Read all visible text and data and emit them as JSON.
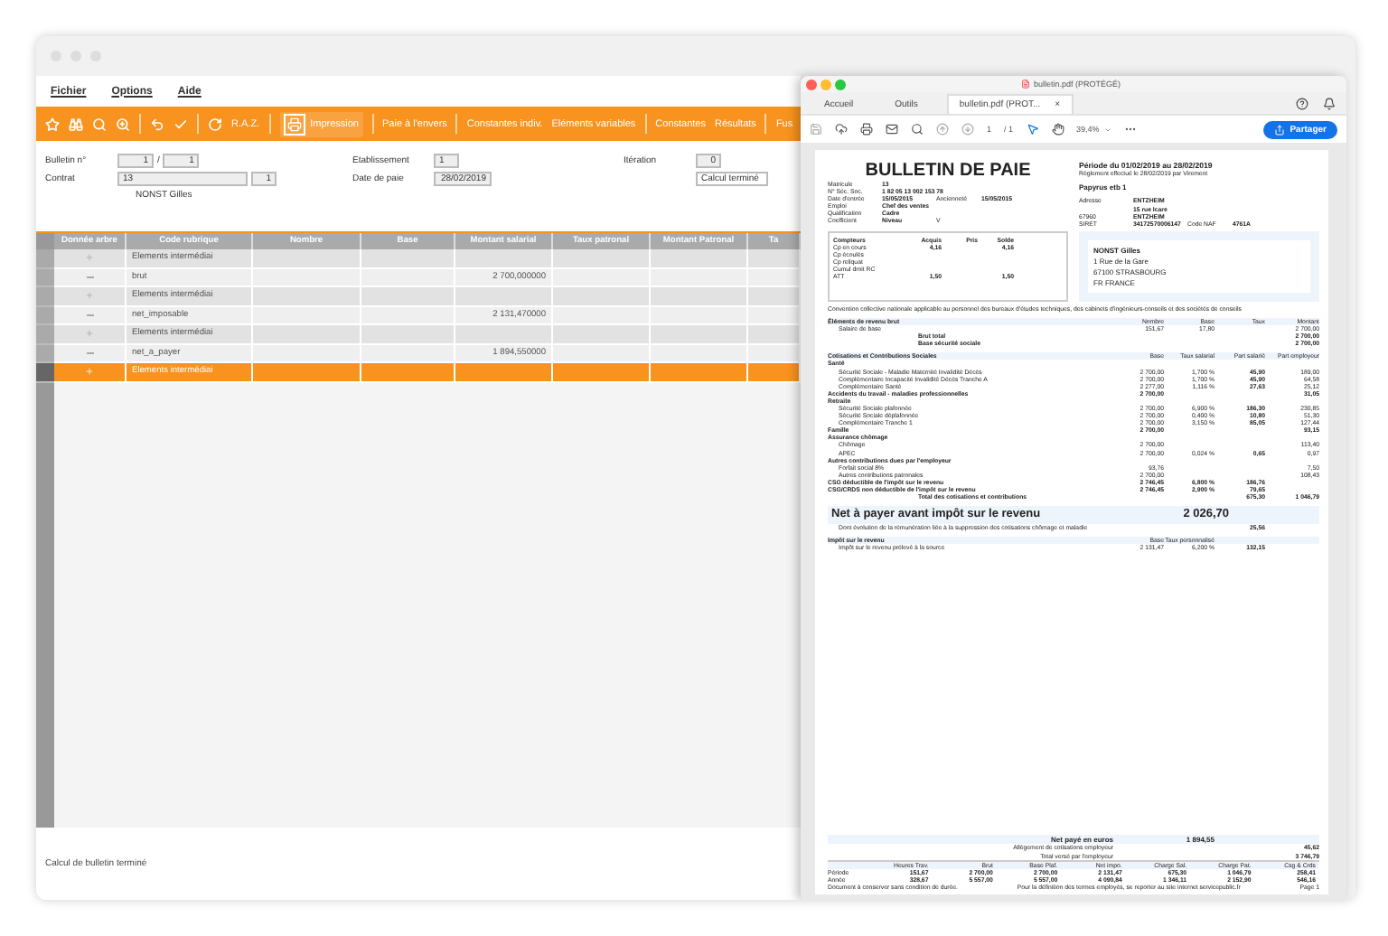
{
  "app": {
    "menu": [
      "Fichier",
      "Options",
      "Aide"
    ],
    "toolbar": [
      {
        "kind": "icon"
      },
      {
        "kind": "icon"
      },
      {
        "kind": "icon"
      },
      {
        "kind": "icon"
      },
      {
        "kind": "sep"
      },
      {
        "kind": "icon"
      },
      {
        "kind": "icon"
      },
      {
        "kind": "sep"
      },
      {
        "kind": "icon"
      },
      {
        "kind": "text",
        "label": "R.A.Z."
      },
      {
        "kind": "sep"
      },
      {
        "kind": "print",
        "label": "Impression",
        "selected": true
      },
      {
        "kind": "sep"
      },
      {
        "kind": "text",
        "label": "Paie à l'envers"
      },
      {
        "kind": "sep"
      },
      {
        "kind": "text",
        "label": "Constantes indiv."
      },
      {
        "kind": "text",
        "label": "Eléments variables"
      },
      {
        "kind": "sep"
      },
      {
        "kind": "text",
        "label": "Constantes"
      },
      {
        "kind": "text",
        "label": "Résultats"
      },
      {
        "kind": "sep"
      },
      {
        "kind": "text",
        "label": "Fus"
      }
    ],
    "form": {
      "bulletin_label": "Bulletin n°",
      "bulletin": "1",
      "bulletin_sep": "/",
      "bulletin_total": "1",
      "etablissement_label": "Etablissement",
      "etablissement": "1",
      "iteration_label": "Itération",
      "iteration": "0",
      "contrat_label": "Contrat",
      "contrat": "13",
      "contrat_num": "1",
      "date_label": "Date de paie",
      "date": "28/02/2019",
      "status": "Calcul terminé",
      "employee": "NONST Gilles"
    },
    "table": {
      "columns": [
        "Donnée arbre",
        "Code rubrique",
        "Nombre",
        "Base",
        "Montant salarial",
        "Taux patronal",
        "Montant Patronal",
        "Ta"
      ],
      "rows": [
        {
          "kind": "group",
          "selected": false,
          "code": "Elements intermédiai"
        },
        {
          "kind": "leaf",
          "selected": false,
          "code": "brut",
          "amount": "2 700,000000"
        },
        {
          "kind": "group",
          "selected": false,
          "code": "Elements intermédiai"
        },
        {
          "kind": "leaf",
          "selected": false,
          "code": "net_imposable",
          "amount": "2 131,470000"
        },
        {
          "kind": "group",
          "selected": false,
          "code": "Elements intermédiai"
        },
        {
          "kind": "leaf",
          "selected": false,
          "code": "net_a_payer",
          "amount": "1 894,550000"
        },
        {
          "kind": "group",
          "selected": true,
          "code": "Elements intermédiai"
        }
      ]
    },
    "status_bar": "Calcul de bulletin terminé"
  },
  "pdf": {
    "window_title": "bulletin.pdf (PROTÉGÉ)",
    "tabs": [
      {
        "label": "Accueil",
        "selected": false
      },
      {
        "label": "Outils",
        "selected": false
      },
      {
        "label": "bulletin.pdf (PROT...",
        "selected": true,
        "close": "×"
      }
    ],
    "page": "1",
    "page_total": "/ 1",
    "zoom": "39,4%",
    "share": "Partager",
    "doc": {
      "title": "BULLETIN DE PAIE",
      "employee_info": [
        [
          "Matricule",
          "13"
        ],
        [
          "N° Séc. Soc.",
          "1 82 05 13 002 153 78"
        ],
        [
          "Date d'entrée",
          "15/05/2015",
          "Ancienneté",
          "15/05/2015"
        ],
        [
          "Emploi",
          "Chef des ventes"
        ],
        [
          "Qualification",
          "Cadre"
        ],
        [
          "Coefficient",
          "Niveau",
          "V"
        ]
      ],
      "period": "Période du 01/02/2019 au 28/02/2019",
      "payment": "Règlement effectué le 28/02/2019 par Virement",
      "company": "Papyrus etb 1",
      "company_address": [
        {
          "label": "Adresse",
          "value": "ENTZHEIM"
        },
        {
          "value": "15 rue Icare"
        },
        {
          "label": "67960",
          "value": "ENTZHEIM"
        }
      ],
      "siret_label": "SIRET",
      "siret": "34172570006147",
      "naf_label": "Code NAF",
      "naf": "4761A",
      "counters": {
        "columns": [
          "Compteurs",
          "Acquis",
          "Pris",
          "Solde"
        ],
        "rows": [
          {
            "label": "Cp en cours",
            "acquis": "4,16",
            "solde": "4,16"
          },
          {
            "label": "Cp écoulés"
          },
          {
            "label": "Cp reliquat"
          },
          {
            "label": "Cumul droit RC"
          },
          {
            "label": "ATT",
            "acquis": "1,50",
            "solde": "1,50"
          }
        ]
      },
      "address": [
        "NONST Gilles",
        "1 Rue de la Gare",
        "67100  STRASBOURG",
        "FR  FRANCE"
      ],
      "convention": "Convention collective nationale applicable au personnel des bureaux d'études techniques, des cabinets d'ingénieurs-conseils et des sociétés de conseils",
      "gross": {
        "kind": "gross",
        "title": "Éléments de revenu brut",
        "columns": [
          "Nombre",
          "Base",
          "Taux",
          "Montant"
        ],
        "rows": [
          {
            "kind": "item",
            "label": "Salaire de base",
            "nombre": "151,67",
            "base": "17,80",
            "montant": "2 700,00"
          },
          {
            "kind": "total",
            "label": "Brut total",
            "montant": "2 700,00"
          },
          {
            "kind": "sub",
            "label": "Base sécurité sociale",
            "montant": "2 700,00"
          }
        ]
      },
      "contrib": {
        "kind": "contrib",
        "title": "Cotisations et Contributions Sociales",
        "columns": [
          "Base",
          "Taux salarial",
          "Part salarié",
          "Part employeur"
        ],
        "rows": [
          {
            "kind": "group",
            "label": "Santé"
          },
          {
            "kind": "item",
            "label": "Sécurité Sociale - Maladie Maternité Invalidité Décès",
            "base": "2 700,00",
            "taux": "1,700 %",
            "salarie": "45,90",
            "employeur": "189,00"
          },
          {
            "kind": "item",
            "label": "Complémentaire Incapacité Invalidité Décès Tranche A",
            "base": "2 700,00",
            "taux": "1,700 %",
            "salarie": "45,90",
            "employeur": "64,58"
          },
          {
            "kind": "item",
            "label": "Complémentaire Santé",
            "base": "2 277,00",
            "taux": "1,116 %",
            "salarie": "27,63",
            "employeur": "25,12"
          },
          {
            "kind": "group",
            "label": "Accidents du travail - maladies professionnelles",
            "base": "2 700,00",
            "employeur": "31,05"
          },
          {
            "kind": "group",
            "label": "Retraite"
          },
          {
            "kind": "item",
            "label": "Sécurité Sociale plafonnée",
            "base": "2 700,00",
            "taux": "6,900 %",
            "salarie": "186,30",
            "employeur": "230,85"
          },
          {
            "kind": "item",
            "label": "Sécurité Sociale déplafonnée",
            "base": "2 700,00",
            "taux": "0,400 %",
            "salarie": "10,80",
            "employeur": "51,30"
          },
          {
            "kind": "item",
            "label": "Complémentaire Tranche 1",
            "base": "2 700,00",
            "taux": "3,150 %",
            "salarie": "85,05",
            "employeur": "127,44"
          },
          {
            "kind": "group",
            "label": "Famille",
            "base": "2 700,00",
            "employeur": "93,15"
          },
          {
            "kind": "group",
            "label": "Assurance chômage"
          },
          {
            "kind": "item",
            "label": "Chômage",
            "base": "2 700,00",
            "employeur": "113,40"
          },
          {
            "kind": "item",
            "label": "APEC",
            "base": "2 700,00",
            "taux": "0,024 %",
            "salarie": "0,65",
            "employeur": "0,97"
          },
          {
            "kind": "group",
            "label": "Autres contributions dues par l'employeur"
          },
          {
            "kind": "item",
            "label": "Forfait social 8%",
            "base": "93,76",
            "employeur": "7,50"
          },
          {
            "kind": "item",
            "label": "Autres contributions patronales",
            "base": "2 700,00",
            "employeur": "108,43"
          },
          {
            "kind": "group",
            "label": "CSG déductible de l'impôt sur le revenu",
            "base": "2 746,45",
            "taux": "6,800 %",
            "salarie": "186,76"
          },
          {
            "kind": "group",
            "label": "CSG/CRDS non déductible de l'impôt sur le revenu",
            "base": "2 746,45",
            "taux": "2,900 %",
            "salarie": "79,65"
          },
          {
            "kind": "total",
            "label": "Total des cotisations et contributions",
            "salarie": "675,30",
            "employeur": "1 046,79"
          }
        ]
      },
      "net_before_tax": {
        "label": "Net à payer avant impôt sur le revenu",
        "value": "2 026,70"
      },
      "evolution": {
        "label": "Dont évolution de la rémunération liée à la suppression des cotisations chômage et maladie",
        "value": "25,56"
      },
      "tax": {
        "title": "Impôt sur le revenu",
        "columns": [
          "Base",
          "Taux personnalisé"
        ],
        "label": "Impôt sur le revenu prélevé à la source",
        "values": [
          "2 131,47",
          "6,200 %",
          "132,15"
        ]
      },
      "net_paid": {
        "label": "Net payé en euros",
        "value": "1 894,55"
      },
      "employer": [
        {
          "label": "Allègement de cotisations employeur",
          "value": "45,62"
        },
        {
          "label": "Total versé par l'employeur",
          "value": "3 746,79"
        }
      ],
      "summary": {
        "columns": [
          "Heures Trav.",
          "Brut",
          "Base Plaf.",
          "Net impo.",
          "Charge Sal.",
          "Charge Pat.",
          "Csg & Crds"
        ],
        "rows": [
          {
            "label": "Période",
            "values": [
              "151,67",
              "2 700,00",
              "2 700,00",
              "2 131,47",
              "675,30",
              "1 046,79",
              "258,41"
            ]
          },
          {
            "label": "Année",
            "values": [
              "328,67",
              "5 557,00",
              "5 557,00",
              "4 090,84",
              "1 346,11",
              "2 152,90",
              "546,16"
            ]
          }
        ]
      },
      "footer": [
        "Document à conserver sans condition de durée.",
        "Pour la définition des termes employés, se reporter au site internet servicepublic.fr",
        "Page  1"
      ]
    }
  }
}
